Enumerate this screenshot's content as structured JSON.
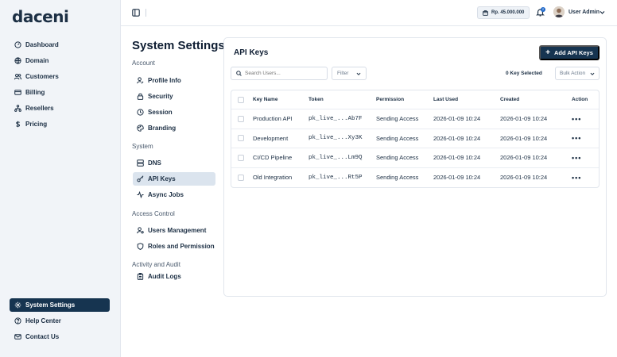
{
  "brand": {
    "name": "daceni",
    "tagline": ""
  },
  "sidebar": {
    "top_items": [
      {
        "label": "Dashboard",
        "icon": "gauge-icon"
      },
      {
        "label": "Domain",
        "icon": "globe-icon"
      },
      {
        "label": "Customers",
        "icon": "users-icon"
      },
      {
        "label": "Billing",
        "icon": "credit-card-icon"
      },
      {
        "label": "Resellers",
        "icon": "network-icon"
      },
      {
        "label": "Pricing",
        "icon": "dollar-icon"
      }
    ],
    "bottom_items": [
      {
        "label": "System Settings",
        "icon": "gear-icon",
        "active": true
      },
      {
        "label": "Help Center",
        "icon": "help-icon"
      },
      {
        "label": "Contact Us",
        "icon": "mail-icon"
      }
    ]
  },
  "header": {
    "balance": "Rp. 45.000.000",
    "notifications_count": "2",
    "user_name": "User Admin"
  },
  "settings": {
    "title": "System Settings",
    "sections": [
      {
        "label": "Account",
        "items": [
          "Profile Info",
          "Security",
          "Session",
          "Branding"
        ]
      },
      {
        "label": "System",
        "items": [
          "DNS",
          "API Keys",
          "Async Jobs"
        ]
      },
      {
        "label": "Access Control",
        "items": [
          "Users Management",
          "Roles and Permission"
        ]
      },
      {
        "label": "Activity and Audit",
        "items": [
          "Audit Logs"
        ]
      }
    ],
    "active_item": "API Keys"
  },
  "api_keys": {
    "title": "API Keys",
    "add_button": "Add API Keys",
    "search_placeholder": "Search Users...",
    "filter_label": "Filter",
    "selected_text": "0 Key Selected",
    "bulk_label": "Bulk Action",
    "columns": [
      "Key Name",
      "Token",
      "Permission",
      "Last Used",
      "Created",
      "Action"
    ],
    "rows": [
      {
        "name": "Production API",
        "token": "pk_live_...Ab7F",
        "permission": "Sending Access",
        "last_used": "2026-01-09 10:24",
        "created": "2026-01-09 10:24",
        "action": "•••"
      },
      {
        "name": "Development",
        "token": "pk_live_...Xy3K",
        "permission": "Sending Access",
        "last_used": "2026-01-09 10:24",
        "created": "2026-01-09 10:24",
        "action": "•••"
      },
      {
        "name": "CI/CD Pipeline",
        "token": "pk_live_...Lm9Q",
        "permission": "Sending Access",
        "last_used": "2026-01-09 10:24",
        "created": "2026-01-09 10:24",
        "action": "•••"
      },
      {
        "name": "Old Integration",
        "token": "pk_live_...Rt5P",
        "permission": "Sending Access",
        "last_used": "2026-01-09 10:24",
        "created": "2026-01-09 10:24",
        "action": "•••"
      }
    ]
  },
  "colors": {
    "primary": "#163450",
    "accent": "#1e67c9",
    "sidebar_bg": "#f1f4f8",
    "active_sub": "#dbe4ee"
  }
}
